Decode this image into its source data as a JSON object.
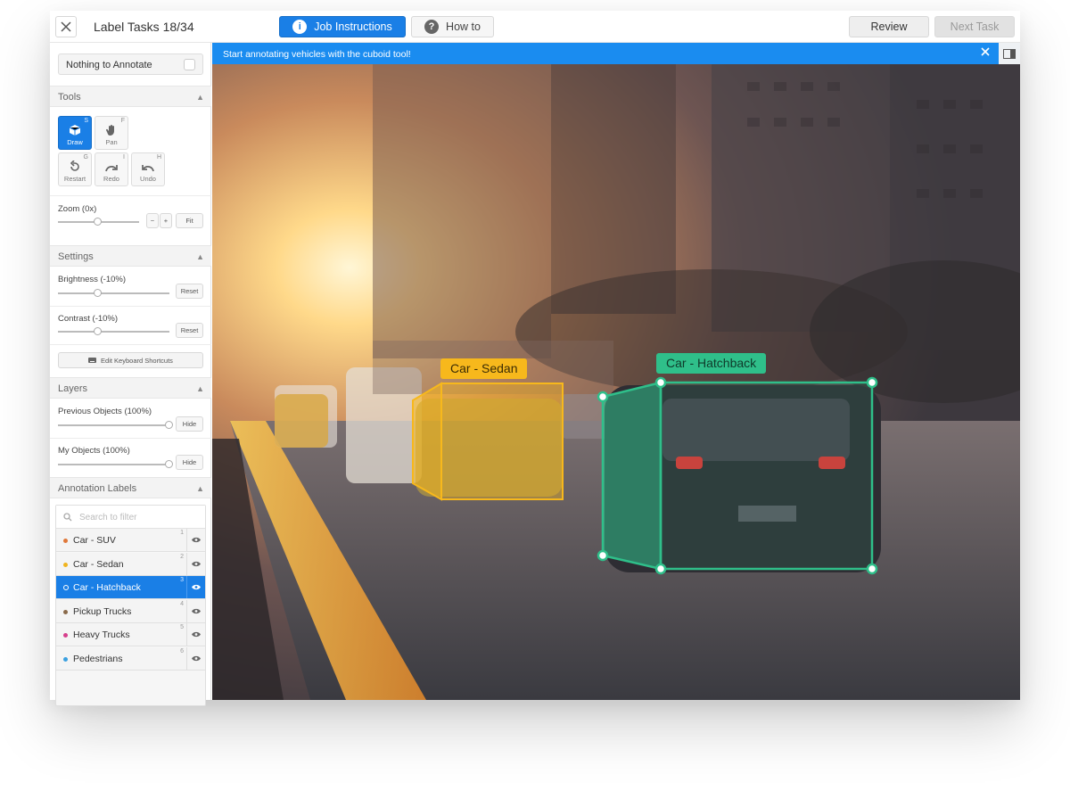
{
  "header": {
    "task_title": "Label Tasks 18/34",
    "job_instructions_label": "Job Instructions",
    "how_to_label": "How to",
    "review_label": "Review",
    "next_task_label": "Next Task"
  },
  "sidebar": {
    "nothing_to_annotate": "Nothing to Annotate",
    "tools_title": "Tools",
    "tools": [
      {
        "label": "Draw",
        "key": "S",
        "icon": "cube-icon"
      },
      {
        "label": "Pan",
        "key": "F",
        "icon": "hand-icon"
      },
      {
        "label": "Restart",
        "key": "G",
        "icon": "restart-icon"
      },
      {
        "label": "Redo",
        "key": "I",
        "icon": "redo-icon"
      },
      {
        "label": "Undo",
        "key": "H",
        "icon": "undo-icon"
      }
    ],
    "zoom_label": "Zoom (0x)",
    "zoom_minus": "−",
    "zoom_plus": "+",
    "fit_label": "Fit",
    "settings_title": "Settings",
    "brightness_label": "Brightness (-10%)",
    "contrast_label": "Contrast (-10%)",
    "reset_label": "Reset",
    "edit_shortcuts_label": "Edit Keyboard Shortcuts",
    "layers_title": "Layers",
    "previous_objects_label": "Previous Objects (100%)",
    "my_objects_label": "My Objects (100%)",
    "hide_label": "Hide",
    "annotation_labels_title": "Annotation Labels",
    "search_placeholder": "Search to filter",
    "labels": [
      {
        "name": "Car - SUV",
        "num": "1",
        "color": "#e0783a"
      },
      {
        "name": "Car - Sedan",
        "num": "2",
        "color": "#f0b41e"
      },
      {
        "name": "Car - Hatchback",
        "num": "3",
        "color": "#2fbf8a"
      },
      {
        "name": "Pickup Trucks",
        "num": "4",
        "color": "#8a6a4a"
      },
      {
        "name": "Heavy Trucks",
        "num": "5",
        "color": "#d63f8c"
      },
      {
        "name": "Pedestrians",
        "num": "6",
        "color": "#3aa0e0"
      }
    ],
    "selected_label_index": 2
  },
  "banner": {
    "message": "Start annotating vehicles with the cuboid tool!"
  },
  "annotations": [
    {
      "label": "Car - Sedan",
      "color": "#f7b81c"
    },
    {
      "label": "Car - Hatchback",
      "color": "#2fbf8a"
    }
  ],
  "colors": {
    "accent": "#1a7fe6",
    "banner": "#1a8cf0",
    "sedan": "#f7b81c",
    "hatchback": "#2fbf8a"
  }
}
